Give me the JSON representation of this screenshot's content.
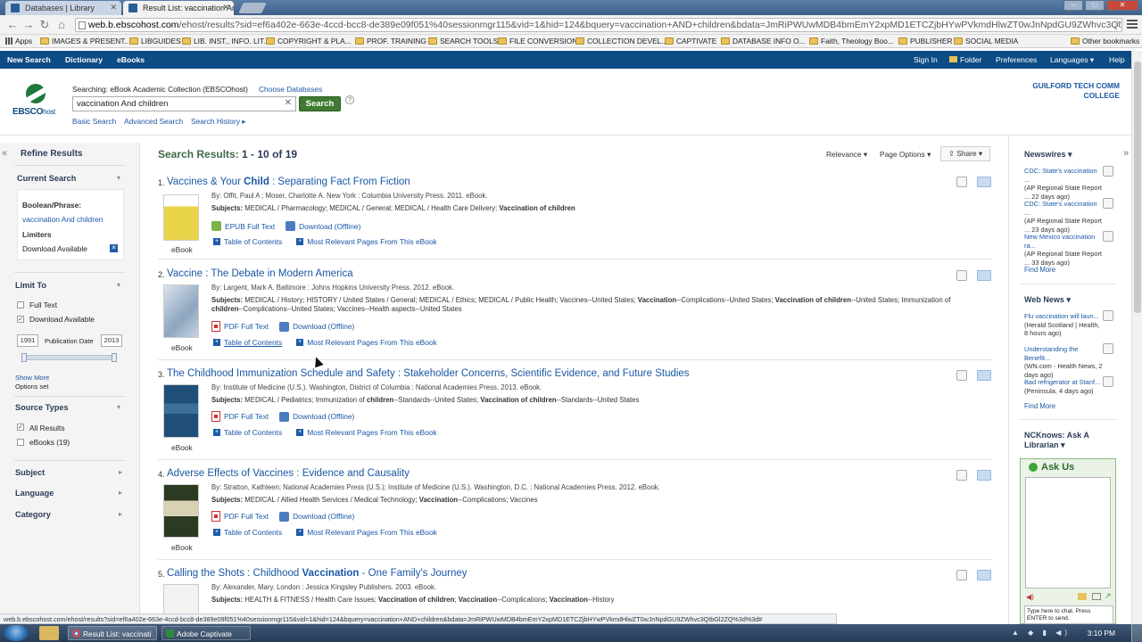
{
  "browser": {
    "tabs": [
      {
        "title": "Databases | Library"
      },
      {
        "title": "Result List: vaccination An"
      }
    ],
    "url_host": "web.b.ebscohost.com",
    "url_path": "/ehost/results?sid=ef6a402e-663e-4ccd-bcc8-de389e09f051%40sessionmgr115&vid=1&hid=124&bquery=vaccination+AND+children&bdata=JmRiPWUwMDB4bmEmY2xpMD1ETCZjbHYwPVkmdHlwZT0wJnNpdGU9ZWhvc3Qtb"
  },
  "bookmarks": [
    {
      "label": "Apps"
    },
    {
      "label": "IMAGES & PRESENT..."
    },
    {
      "label": "LIBGUIDES"
    },
    {
      "label": "LIB. INST., INFO. LIT."
    },
    {
      "label": "COPYRIGHT & PLA..."
    },
    {
      "label": "PROF. TRAINING"
    },
    {
      "label": "SEARCH TOOLS"
    },
    {
      "label": "FILE CONVERSION"
    },
    {
      "label": "COLLECTION DEVEL..."
    },
    {
      "label": "CAPTIVATE"
    },
    {
      "label": "DATABASE INFO O..."
    },
    {
      "label": "Faith, Theology Boo..."
    },
    {
      "label": "PUBLISHER"
    },
    {
      "label": "SOCIAL MEDIA"
    },
    {
      "label": "Other bookmarks"
    }
  ],
  "topnav": {
    "new_search": "New Search",
    "dictionary": "Dictionary",
    "ebooks": "eBooks",
    "sign_in": "Sign In",
    "folder": "Folder",
    "preferences": "Preferences",
    "languages": "Languages ▾",
    "help": "Help"
  },
  "header": {
    "logo": "EBSCO",
    "logo_suffix": "host",
    "searching": "Searching: eBook Academic Collection (EBSCOhost)",
    "choose_db": "Choose Databases",
    "query": "vaccination And children",
    "search_btn": "Search",
    "basic": "Basic Search",
    "advanced": "Advanced Search",
    "history": "Search History ▸",
    "inst_line1": "GUILFORD TECH COMM",
    "inst_line2": "COLLEGE"
  },
  "sidebar": {
    "refine": "Refine Results",
    "current_search": "Current Search",
    "boolean_label": "Boolean/Phrase:",
    "boolean_value": "vaccination And children",
    "limiters": "Limiters",
    "limiter_value": "Download Available",
    "limit_to": "Limit To",
    "full_text": "Full Text",
    "download_avail": "Download Available",
    "year_from": "1991",
    "pub_date": "Publication Date",
    "year_to": "2013",
    "show_more": "Show More",
    "options_set": "Options set",
    "source_types": "Source Types",
    "all_results": "All Results",
    "ebooks": "eBooks (19)",
    "subject": "Subject",
    "language": "Language",
    "category": "Category"
  },
  "results_header": {
    "label": "Search Results:",
    "range": "1 - 10 of 19",
    "relevance": "Relevance ▾",
    "page_options": "Page Options ▾",
    "share": "Share ▾"
  },
  "results": [
    {
      "num": "1.",
      "title_a": "Vaccines & Your ",
      "title_b": "Child",
      "title_c": " : Separating Fact From Fiction",
      "by": "By: Offit, Paul A ; Moser, Charlotte A. New York : Columbia University Press. 2011. eBook.",
      "subjects": "<b>Subjects:</b> MEDICAL / Pharmacology; MEDICAL / General; MEDICAL / Health Care Delivery; <b>Vaccination of children</b>",
      "ft": "EPUB Full Text",
      "dl": "Download (Offline)",
      "toc": "Table of Contents",
      "mrp": "Most Relevant Pages From This eBook",
      "ebook": "eBook",
      "cover_color": "#e9d44a"
    },
    {
      "num": "2.",
      "title_a": "Vaccine : The Debate in Modern America",
      "title_b": "",
      "title_c": "",
      "by": "By: Largent, Mark A. Baltimore : Johns Hopkins University Press. 2012. eBook.",
      "subjects": "<b>Subjects:</b> MEDICAL / History; HISTORY / United States / General; MEDICAL / Ethics; MEDICAL / Public Health; Vaccines--United States; <b>Vaccination</b>--Complications--United States; <b>Vaccination of children</b>--United States; Immunization of <b>children</b>--Complications--United States; Vaccines--Health aspects--United States",
      "ft": "PDF Full Text",
      "dl": "Download (Offline)",
      "toc": "Table of Contents",
      "mrp": "Most Relevant Pages From This eBook",
      "ebook": "eBook",
      "cover_color": "#b9c7d6"
    },
    {
      "num": "3.",
      "title_a": "The Childhood Immunization Schedule and Safety : Stakeholder Concerns, Scientific Evidence, and Future Studies",
      "title_b": "",
      "title_c": "",
      "by": "By: Institute of Medicine (U.S.). Washington, District of Columbia : National Academies Press. 2013. eBook.",
      "subjects": "<b>Subjects:</b> MEDICAL / Pediatrics; Immunization of <b>children</b>--Standards--United States; <b>Vaccination of children</b>--Standards--United States",
      "ft": "PDF Full Text",
      "dl": "Download (Offline)",
      "toc": "Table of Contents",
      "mrp": "Most Relevant Pages From This eBook",
      "ebook": "eBook",
      "cover_color": "#1f4f78"
    },
    {
      "num": "4.",
      "title_a": "Adverse Effects of Vaccines : Evidence and Causality",
      "title_b": "",
      "title_c": "",
      "by": "By: Stratton, Kathleen; National Academies Press (U.S.); Institute of Medicine (U.S.). Washington, D.C. : National Academies Press. 2012. eBook.",
      "subjects": "<b>Subjects:</b> MEDICAL / Allied Health Services / Medical Technology; <b>Vaccination</b>--Complications; Vaccines",
      "ft": "PDF Full Text",
      "dl": "Download (Offline)",
      "toc": "Table of Contents",
      "mrp": "Most Relevant Pages From This eBook",
      "ebook": "eBook",
      "cover_color": "#2c3a22"
    },
    {
      "num": "5.",
      "title_a": "Calling the Shots : Childhood ",
      "title_b": "Vaccination",
      "title_c": " - One Family's Journey",
      "by": "By: Alexander, Mary. London : Jessica Kingsley Publishers. 2003. eBook.",
      "subjects": "<b>Subjects:</b> HEALTH & FITNESS / Health Care Issues; <b>Vaccination of children</b>; <b>Vaccination</b>--Complications; <b>Vaccination</b>--History",
      "ft": "",
      "dl": "",
      "toc": "",
      "mrp": "",
      "ebook": "",
      "cover_color": "#eeeeee"
    }
  ],
  "right": {
    "newswires": "Newswires ▾",
    "news": [
      {
        "link": "CDC: State's vaccination ...",
        "meta": "(AP Regional State Report ... 22 days ago)"
      },
      {
        "link": "CDC: State's vaccination ...",
        "meta": "(AP Regional State Report ... 23 days ago)"
      },
      {
        "link": "New Mexico vaccination ra...",
        "meta": "(AP Regional State Report ... 33 days ago)"
      }
    ],
    "find_more": "Find More",
    "web_news": "Web News ▾",
    "web": [
      {
        "link": "Flu vaccination will laun...",
        "meta": "(Herald Scotland | Health, 8 hours ago)"
      },
      {
        "link": "Understanding the Benefit...",
        "meta": "(WN.com - Health News, 2 days ago)"
      },
      {
        "link": "Bad refrigerator at Stanf...",
        "meta": "(Peninsula, 4 days ago)"
      }
    ],
    "ncknows": "NCKnows: Ask A Librarian ▾",
    "ask_us": "Ask Us",
    "chat_hint": "Type here to chat. Press ENTER to send."
  },
  "status_url": "web.b.ebscohost.com/ehost/results?sid=ef6a402e-663e-4ccd-bcc8-de389e09f051%40sessionmgr115&vid=1&hid=124&bquery=vaccination+AND+children&bdata=JmRiPWUwMDB4bmEmY2xpMD1ETCZjbHYwPVkmdHlwZT0wJnNpdGU9ZWhvc3QtbGl2ZQ%3d%3d#",
  "taskbar": {
    "task1": "Result List: vaccinati",
    "task2": "Adobe Captivate",
    "clock": "3:10 PM"
  }
}
